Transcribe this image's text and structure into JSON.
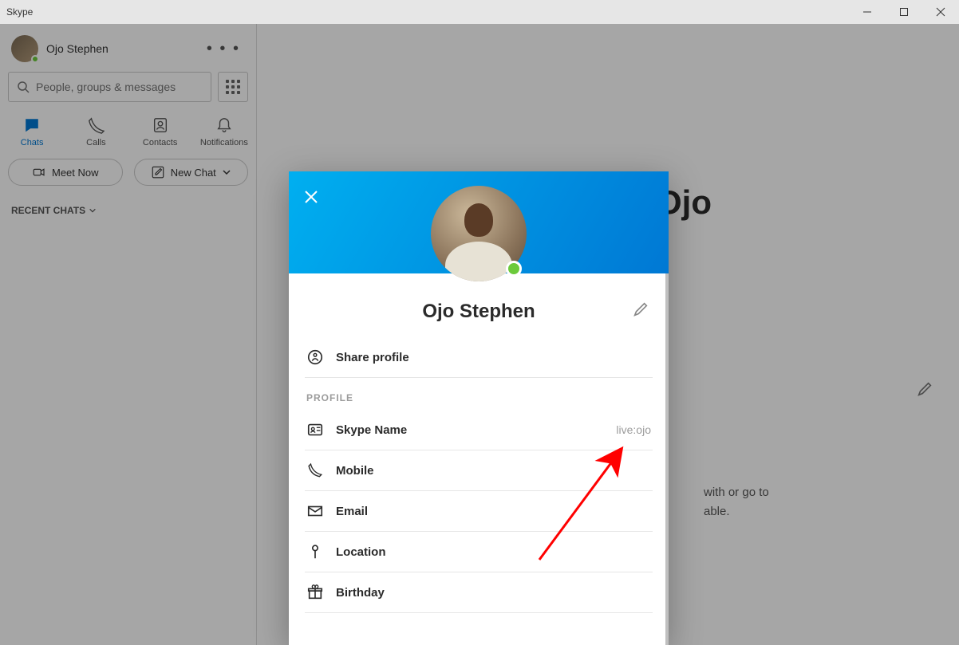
{
  "window": {
    "title": "Skype"
  },
  "sidebar": {
    "user_name": "Ojo Stephen",
    "more_glyph": "• • •",
    "search_placeholder": "People, groups & messages",
    "tabs": {
      "chats": "Chats",
      "calls": "Calls",
      "contacts": "Contacts",
      "notifications": "Notifications"
    },
    "meet_now": "Meet Now",
    "new_chat": "New Chat",
    "recent_label": "RECENT CHATS"
  },
  "main": {
    "display_name": "Ojo",
    "hint_line1": "with or go to",
    "hint_line2": "able."
  },
  "modal": {
    "name": "Ojo Stephen",
    "share_profile": "Share profile",
    "section_profile": "PROFILE",
    "rows": {
      "skype_name_label": "Skype Name",
      "skype_name_value": "live:ojo",
      "mobile": "Mobile",
      "email": "Email",
      "location": "Location",
      "birthday": "Birthday"
    }
  }
}
